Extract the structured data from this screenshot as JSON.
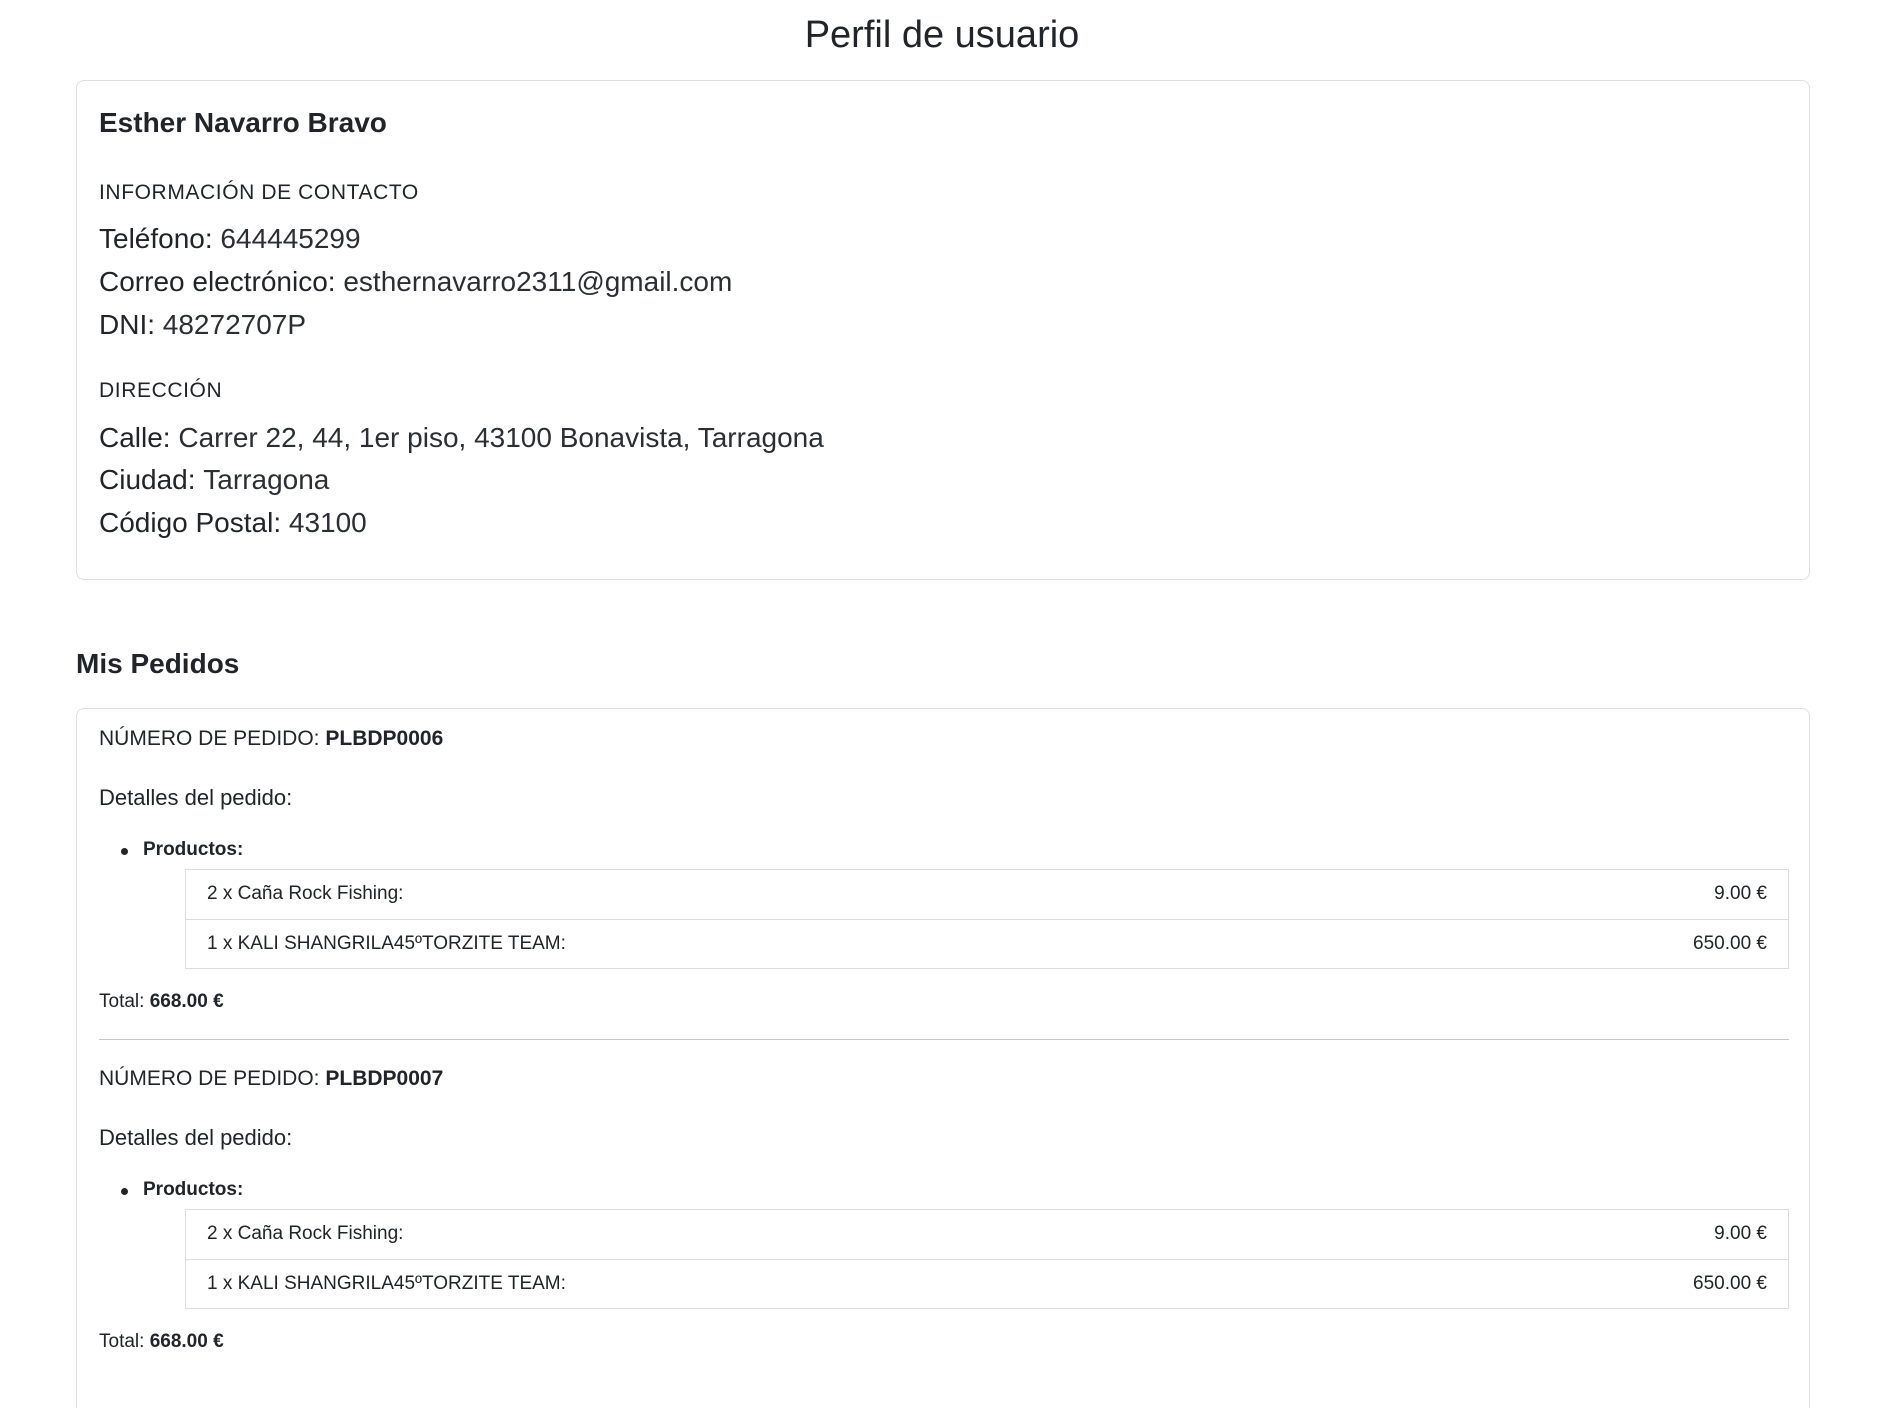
{
  "page": {
    "title": "Perfil de usuario"
  },
  "profile": {
    "name": "Esther Navarro Bravo",
    "contact_heading": "INFORMACIÓN DE CONTACTO",
    "phone_label": "Teléfono:",
    "phone_value": "644445299",
    "email_label": "Correo electrónico:",
    "email_value": "esthernavarro2311@gmail.com",
    "dni_label": "DNI:",
    "dni_value": "48272707P",
    "address_heading": "DIRECCIÓN",
    "street_label": "Calle:",
    "street_value": "Carrer 22, 44, 1er piso, 43100 Bonavista, Tarragona",
    "city_label": "Ciudad:",
    "city_value": "Tarragona",
    "postal_label": "Código Postal:",
    "postal_value": "43100"
  },
  "orders": {
    "heading": "Mis Pedidos",
    "order_number_label": "NÚMERO DE PEDIDO:",
    "details_label": "Detalles del pedido:",
    "products_label": "Productos:",
    "total_label": "Total:",
    "items": [
      {
        "number": "PLBDP0006",
        "products": [
          {
            "name": "2 x Caña Rock Fishing:",
            "price": "9.00 €"
          },
          {
            "name": "1 x KALI SHANGRILA45ºTORZITE TEAM:",
            "price": "650.00 €"
          }
        ],
        "total": "668.00 €"
      },
      {
        "number": "PLBDP0007",
        "products": [
          {
            "name": "2 x Caña Rock Fishing:",
            "price": "9.00 €"
          },
          {
            "name": "1 x KALI SHANGRILA45ºTORZITE TEAM:",
            "price": "650.00 €"
          }
        ],
        "total": "668.00 €"
      }
    ]
  }
}
